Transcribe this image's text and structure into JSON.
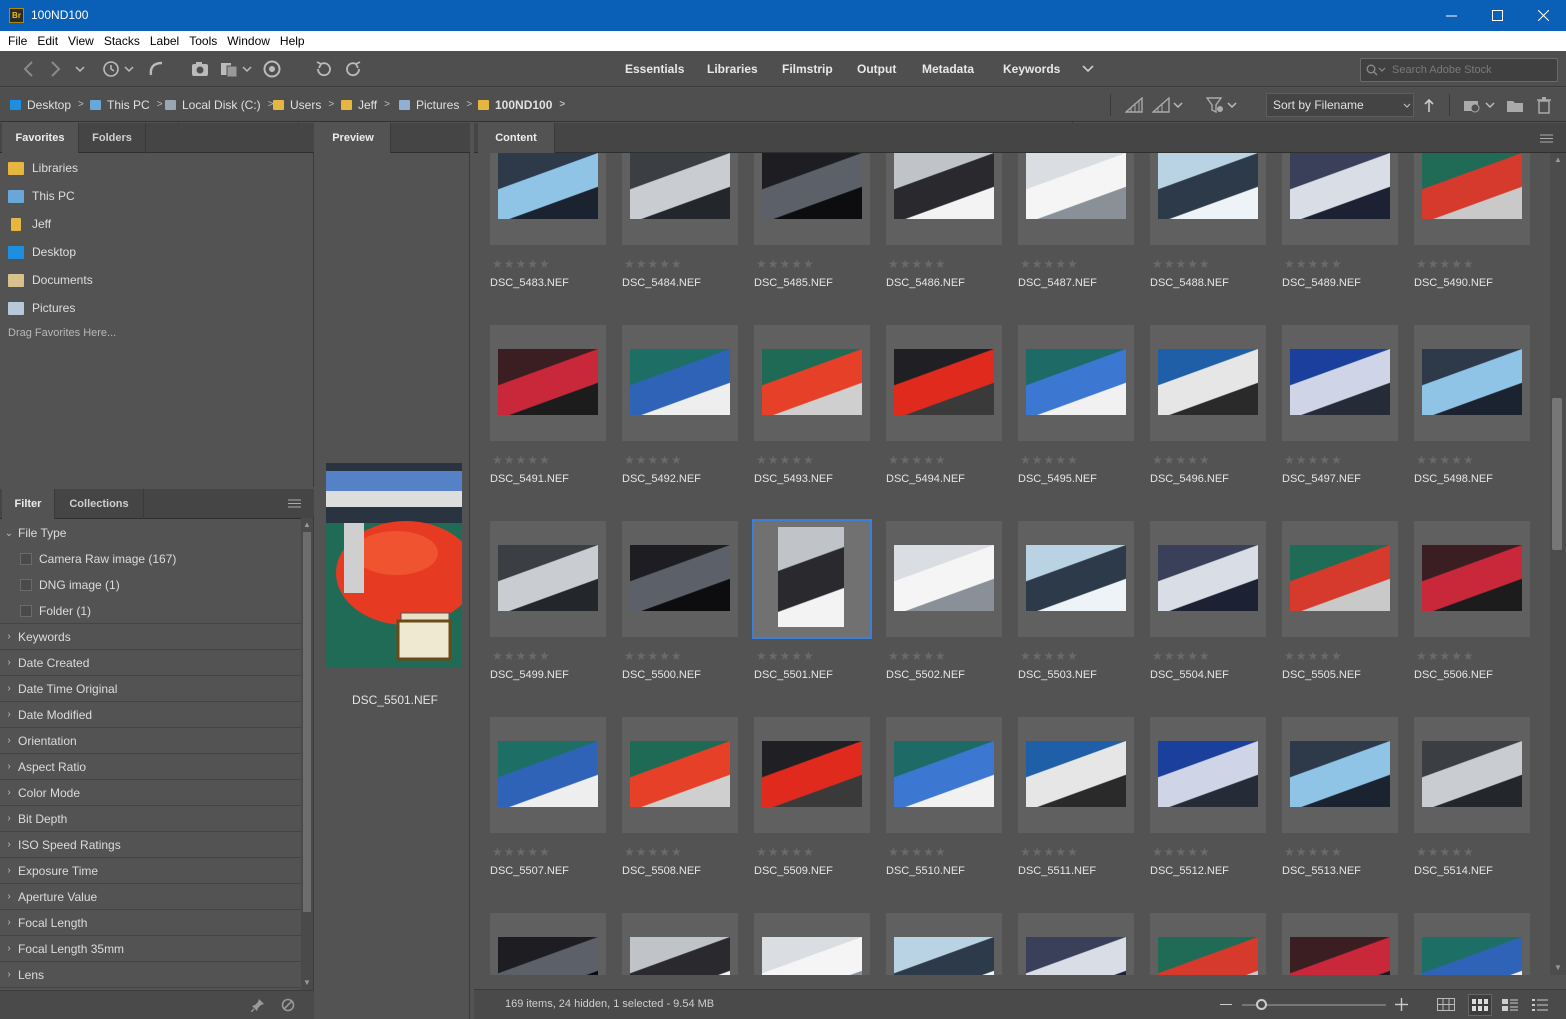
{
  "window": {
    "title": "100ND100",
    "app_icon": "Br"
  },
  "menu": [
    "File",
    "Edit",
    "View",
    "Stacks",
    "Label",
    "Tools",
    "Window",
    "Help"
  ],
  "workspaces": [
    "Essentials",
    "Libraries",
    "Filmstrip",
    "Output",
    "Metadata",
    "Keywords"
  ],
  "search": {
    "placeholder": "Search Adobe Stock"
  },
  "breadcrumbs": [
    "Desktop",
    "This PC",
    "Local Disk (C:)",
    "Users",
    "Jeff",
    "Pictures",
    "100ND100"
  ],
  "sort": {
    "label": "Sort by Filename"
  },
  "favorites_panel": {
    "tabs": [
      "Favorites",
      "Folders"
    ],
    "items": [
      "Libraries",
      "This PC",
      "Jeff",
      "Desktop",
      "Documents",
      "Pictures"
    ],
    "hint": "Drag Favorites Here..."
  },
  "filter_panel": {
    "tabs": [
      "Filter",
      "Collections"
    ],
    "file_type": {
      "label": "File Type",
      "options": [
        "Camera Raw image (167)",
        "DNG image (1)",
        "Folder (1)"
      ]
    },
    "categories": [
      "Keywords",
      "Date Created",
      "Date Time Original",
      "Date Modified",
      "Orientation",
      "Aspect Ratio",
      "Color Mode",
      "Bit Depth",
      "ISO Speed Ratings",
      "Exposure Time",
      "Aperture Value",
      "Focal Length",
      "Focal Length 35mm",
      "Lens"
    ]
  },
  "preview_panel": {
    "tab": "Preview",
    "filename": "DSC_5501.NEF"
  },
  "content_panel": {
    "tab": "Content",
    "rows": [
      [
        "DSC_5483.NEF",
        "DSC_5484.NEF",
        "DSC_5485.NEF",
        "DSC_5486.NEF",
        "DSC_5487.NEF",
        "DSC_5488.NEF",
        "DSC_5489.NEF",
        "DSC_5490.NEF"
      ],
      [
        "DSC_5491.NEF",
        "DSC_5492.NEF",
        "DSC_5493.NEF",
        "DSC_5494.NEF",
        "DSC_5495.NEF",
        "DSC_5496.NEF",
        "DSC_5497.NEF",
        "DSC_5498.NEF"
      ],
      [
        "DSC_5499.NEF",
        "DSC_5500.NEF",
        "DSC_5501.NEF",
        "DSC_5502.NEF",
        "DSC_5503.NEF",
        "DSC_5504.NEF",
        "DSC_5505.NEF",
        "DSC_5506.NEF"
      ],
      [
        "DSC_5507.NEF",
        "DSC_5508.NEF",
        "DSC_5509.NEF",
        "DSC_5510.NEF",
        "DSC_5511.NEF",
        "DSC_5512.NEF",
        "DSC_5513.NEF",
        "DSC_5514.NEF"
      ],
      [
        "",
        "",
        "",
        "",
        "",
        "",
        "",
        ""
      ]
    ],
    "selected": "DSC_5501.NEF",
    "stars": "★★★★★"
  },
  "status": {
    "text": "169 items, 24 hidden, 1 selected - 9.54 MB"
  },
  "colors": {
    "accent": "#0a5fb6",
    "selection": "#3c7fd8",
    "panel": "#535353",
    "folder": "#e6b640"
  }
}
